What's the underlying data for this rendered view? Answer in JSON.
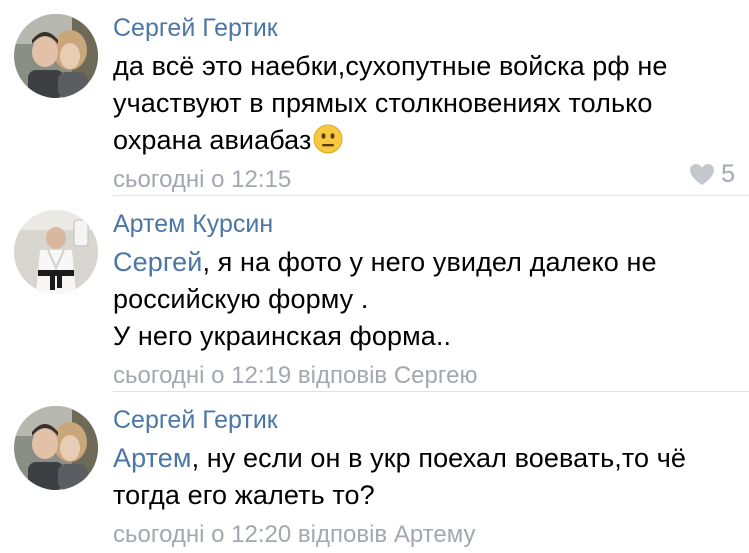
{
  "comments": [
    {
      "author": "Сергей Гертик",
      "avatar_icon": "avatar-couple-photo",
      "mention": "",
      "lines": [
        "да всё это наебки,сухопутные войска рф не",
        "участвуют в прямых столкновениях только",
        "охрана авиабаз"
      ],
      "emoji": "neutral-face-emoji",
      "time": "сьогодні о 12:15",
      "reply_to": "",
      "likes": "5"
    },
    {
      "author": "Артем Курсин",
      "avatar_icon": "avatar-karate-selfie",
      "mention": "Сергей",
      "lines": [
        ", я на фото у него увидел далеко не",
        "российскую форму .",
        "У него украинская форма.."
      ],
      "time": "сьогодні о 12:19",
      "reply_to": "відповів Сергею"
    },
    {
      "author": "Сергей Гертик",
      "avatar_icon": "avatar-couple-photo",
      "mention": "Артем",
      "lines": [
        ", ну если он в укр поехал воевать,то чё",
        "тогда его жалеть то?"
      ],
      "time": "сьогодні о 12:20",
      "reply_to": "відповів Артему"
    }
  ],
  "colors": {
    "link": "#4b76a6",
    "meta": "#a3a8b0",
    "divider": "#dfe2e6"
  }
}
